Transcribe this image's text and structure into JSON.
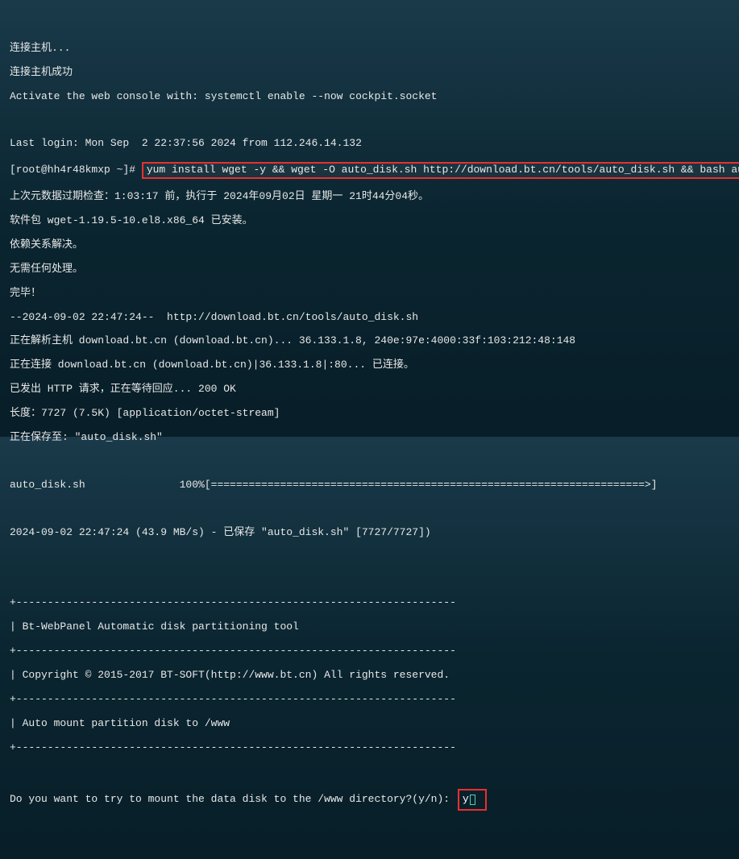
{
  "lines": {
    "l01": "连接主机...",
    "l02": "连接主机成功",
    "l03": "Activate the web console with: systemctl enable --now cockpit.socket",
    "l04": "",
    "l05": "Last login: Mon Sep  2 22:37:56 2024 from 112.246.14.132",
    "prompt": "[root@hh4r48kmxp ~]# ",
    "cmd": "yum install wget -y && wget -O auto_disk.sh http://download.bt.cn/tools/auto_disk.sh && bash auto_disk.sh",
    "l07": "上次元数据过期检查：1:03:17 前，执行于 2024年09月02日 星期一 21时44分04秒。",
    "l08": "软件包 wget-1.19.5-10.el8.x86_64 已安装。",
    "l09": "依赖关系解决。",
    "l10": "无需任何处理。",
    "l11": "完毕！",
    "l12": "--2024-09-02 22:47:24--  http://download.bt.cn/tools/auto_disk.sh",
    "l13": "正在解析主机 download.bt.cn (download.bt.cn)... 36.133.1.8, 240e:97e:4000:33f:103:212:48:148",
    "l14": "正在连接 download.bt.cn (download.bt.cn)|36.133.1.8|:80... 已连接。",
    "l15": "已发出 HTTP 请求，正在等待回应... 200 OK",
    "l16": "长度：7727 (7.5K) [application/octet-stream]",
    "l17": "正在保存至: \"auto_disk.sh\"",
    "l18": "",
    "l19": "auto_disk.sh               100%[=====================================================================>]",
    "l20": "",
    "l21": "2024-09-02 22:47:24 (43.9 MB/s) - 已保存 \"auto_disk.sh\" [7727/7727])",
    "l22": "",
    "l23": "",
    "l24": "+----------------------------------------------------------------------",
    "l25": "| Bt-WebPanel Automatic disk partitioning tool",
    "l26": "+----------------------------------------------------------------------",
    "l27": "| Copyright © 2015-2017 BT-SOFT(http://www.bt.cn) All rights reserved.",
    "l28": "+----------------------------------------------------------------------",
    "l29": "| Auto mount partition disk to /www",
    "l30": "+----------------------------------------------------------------------",
    "l31": "",
    "question": "Do you want to try to mount the data disk to the /www directory?(y/n): ",
    "answer": "y"
  }
}
